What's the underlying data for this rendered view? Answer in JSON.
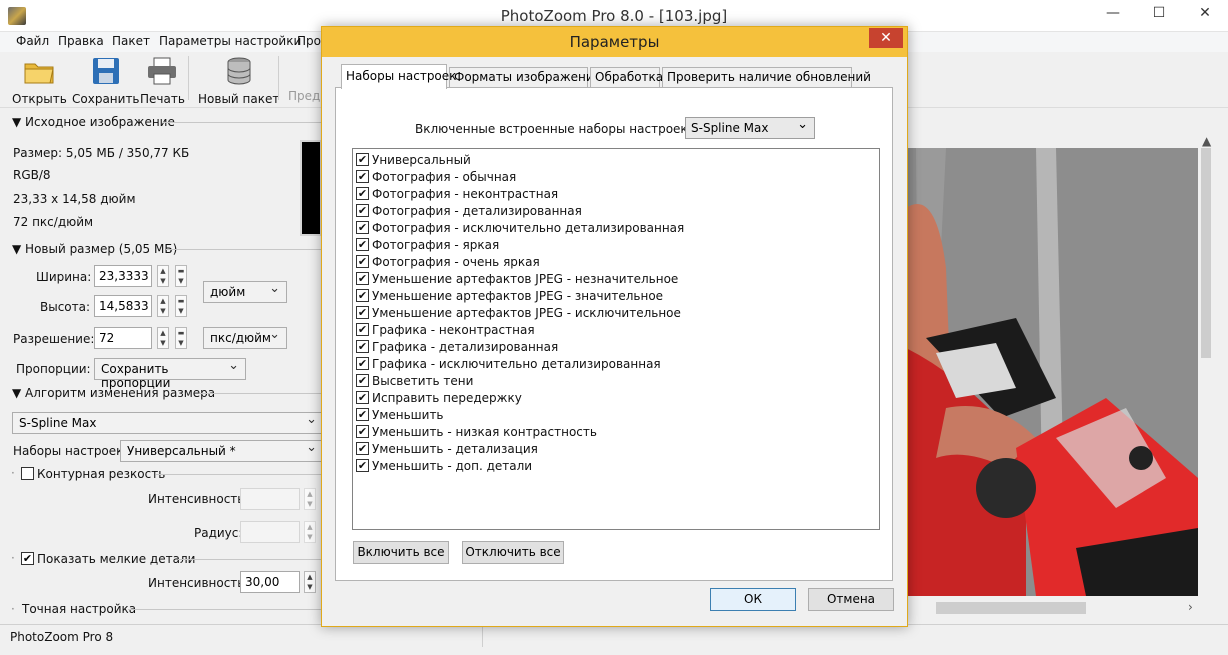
{
  "window": {
    "title": "PhotoZoom Pro 8.0 - [103.jpg]",
    "minimize": "—",
    "maximize": "☐",
    "close": "✕"
  },
  "menu": [
    "Файл",
    "Правка",
    "Пакет",
    "Параметры настройки",
    "Про"
  ],
  "toolbar": {
    "open": "Открыть",
    "save": "Сохранить",
    "print": "Печать",
    "new_batch": "Новый пакет",
    "preview": "Предв"
  },
  "source": {
    "header": "▼ Исходное изображение",
    "size": "Размер: 5,05 МБ / 350,77 КБ",
    "mode": "RGB/8",
    "dims": "23,33 x 14,58 дюйм",
    "dpi": "72 пкс/дюйм"
  },
  "new_size": {
    "header": "▼ Новый размер (5,05 МБ)",
    "width_label": "Ширина:",
    "width_value": "23,3333",
    "height_label": "Высота:",
    "height_value": "14,5833",
    "unit": "дюйм",
    "res_label": "Разрешение:",
    "res_value": "72",
    "res_unit": "пкс/дюйм",
    "prop_label": "Пропорции:",
    "prop_value": "Сохранить пропорции"
  },
  "algorithm": {
    "header": "▼ Алгоритм изменения размера",
    "method": "S-Spline Max",
    "presets_label": "Наборы настроек:",
    "presets_value": "Универсальный *",
    "sharpness_label": "Контурная резкость",
    "intensity_label": "Интенсивность:",
    "radius_label": "Радиус:",
    "details_label": "Показать мелкие детали",
    "details_check": "✔",
    "details_intensity_label": "Интенсивность:",
    "details_intensity_value": "30,00",
    "fine_tune": "Точная настройка"
  },
  "status": {
    "app_name": "PhotoZoom Pro 8"
  },
  "dialog": {
    "title": "Параметры",
    "close": "✕",
    "tabs": [
      "Наборы настроек",
      "Форматы изображений",
      "Обработка",
      "Проверить наличие обновлений"
    ],
    "preset_for_label": "Включенные встроенные наборы настроек для:",
    "preset_for_value": "S-Spline Max",
    "check_mark": "✔",
    "items": [
      "Универсальный",
      "Фотография - обычная",
      "Фотография - неконтрастная",
      "Фотография - детализированная",
      "Фотография - исключительно детализированная",
      "Фотография - яркая",
      "Фотография - очень яркая",
      "Уменьшение артефактов JPEG - незначительное",
      "Уменьшение артефактов JPEG - значительное",
      "Уменьшение артефактов JPEG - исключительное",
      "Графика - неконтрастная",
      "Графика - детализированная",
      "Графика - исключительно детализированная",
      "Высветить тени",
      "Исправить передержку",
      "Уменьшить",
      "Уменьшить - низкая контрастность",
      "Уменьшить - детализация",
      "Уменьшить - доп. детали"
    ],
    "enable_all": "Включить все",
    "disable_all": "Отключить все",
    "ok": "ОК",
    "cancel": "Отмена"
  }
}
